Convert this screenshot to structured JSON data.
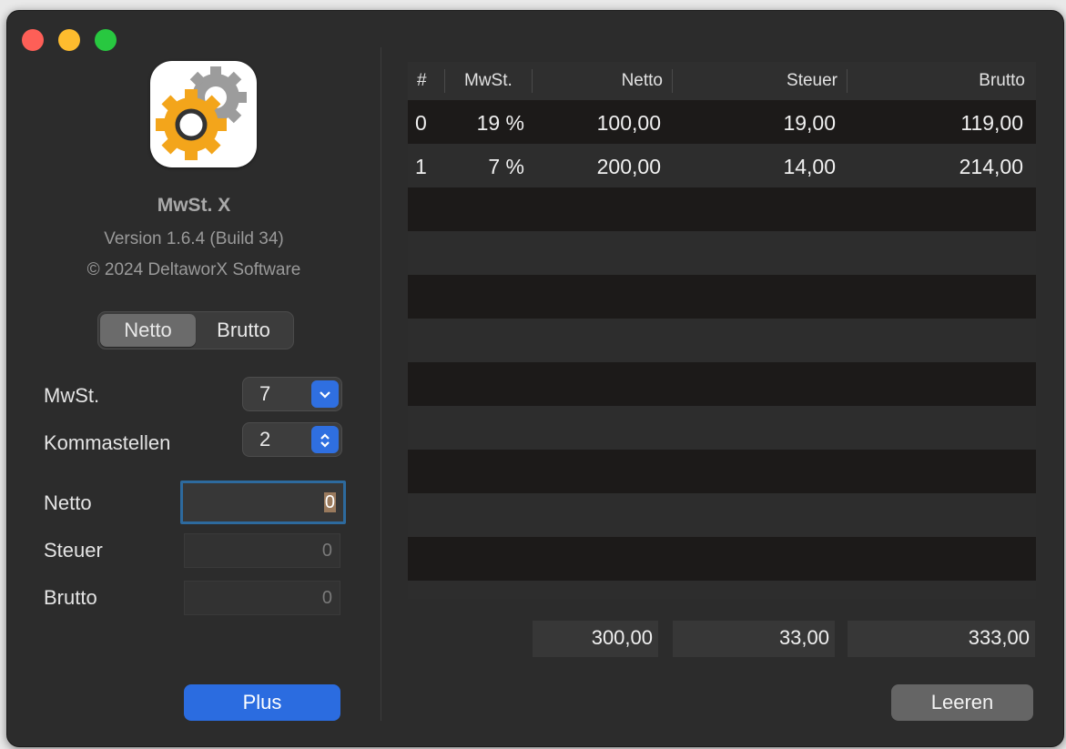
{
  "app": {
    "name": "MwSt. X",
    "version": "Version 1.6.4 (Build 34)",
    "copyright": "© 2024 DeltaworX Software",
    "icon": "gear-icon"
  },
  "mode": {
    "options": [
      "Netto",
      "Brutto"
    ],
    "selected": "Netto"
  },
  "form": {
    "mwst_label": "MwSt.",
    "mwst_value": "7",
    "kommastellen_label": "Kommastellen",
    "kommastellen_value": "2",
    "netto_label": "Netto",
    "netto_value": "0",
    "steuer_label": "Steuer",
    "steuer_value": "0",
    "brutto_label": "Brutto",
    "brutto_value": "0",
    "plus_label": "Plus"
  },
  "table": {
    "columns": [
      "#",
      "MwSt.",
      "Netto",
      "Steuer",
      "Brutto"
    ],
    "rows": [
      [
        "0",
        "19 %",
        "100,00",
        "19,00",
        "119,00"
      ],
      [
        "1",
        "7 %",
        "200,00",
        "14,00",
        "214,00"
      ]
    ]
  },
  "totals": {
    "netto": "300,00",
    "steuer": "33,00",
    "brutto": "333,00"
  },
  "actions": {
    "clear_label": "Leeren"
  },
  "colors": {
    "accent": "#2b6ce0",
    "close": "#fe5f57",
    "minimize": "#febc2e",
    "maximize": "#28c840"
  }
}
